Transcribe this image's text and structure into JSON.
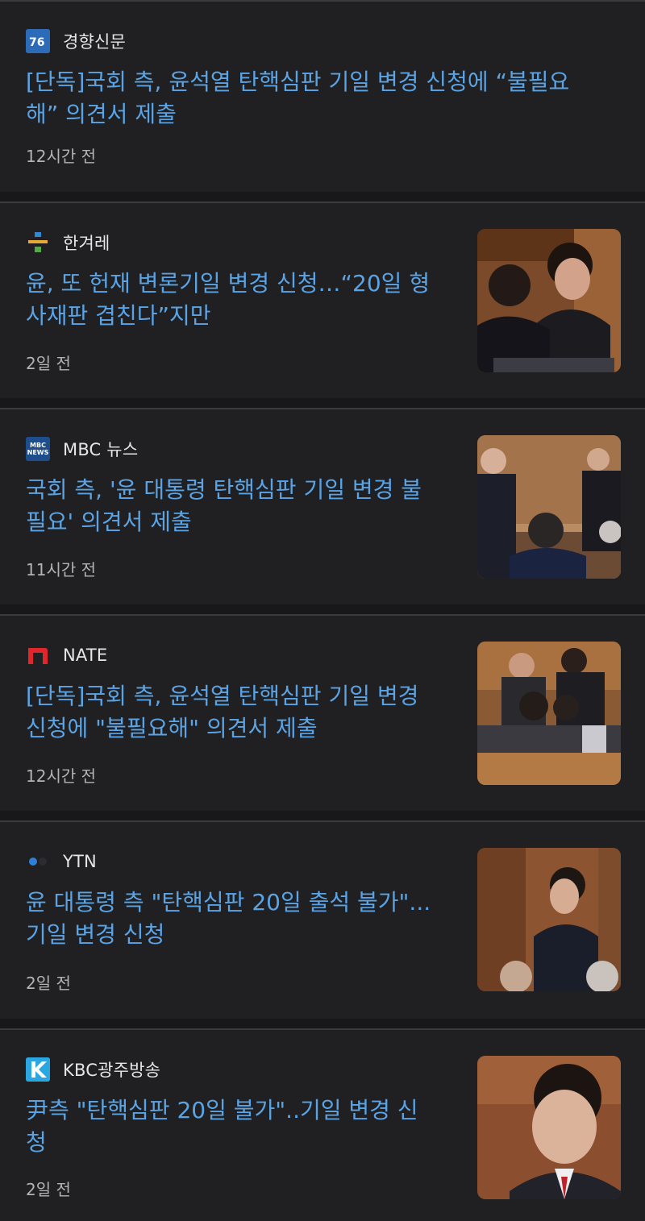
{
  "articles": [
    {
      "source": "경향신문",
      "logo": "kh-logo",
      "title": "[단독]국회 측, 윤석열 탄핵심판 기일 변경 신청에 “불필요해” 의견서 제출",
      "title_line1": "[단독]국회 측, 윤석열 탄핵심판 기일 변경 신청에 “불필요",
      "title_line2": "해” 의견서 제출",
      "time": "12시간 전"
    },
    {
      "source": "한겨레",
      "logo": "hani-logo",
      "title": "윤, 또 헌재 변론기일 변경 신청…“20일 형사재판 겹친다”지만",
      "title_line1": "윤, 또 헌재 변론기일 변경 신청…“20일 형",
      "title_line2": "사재판 겹친다”지만",
      "time": "2일 전"
    },
    {
      "source": "MBC 뉴스",
      "logo": "mbc-news-logo",
      "logo_text": "MBC NEWS",
      "title": "국회 측, '윤 대통령 탄핵심판 기일 변경 불필요' 의견서 제출",
      "title_line1": "국회 측, '윤 대통령 탄핵심판 기일 변경 불",
      "title_line2": "필요' 의견서 제출",
      "time": "11시간 전"
    },
    {
      "source": "NATE",
      "logo": "nate-logo",
      "title": "[단독]국회 측, 윤석열 탄핵심판 기일 변경 신청에 \"불필요해\" 의견서 제출",
      "title_line1": "[단독]국회 측, 윤석열 탄핵심판 기일 변경",
      "title_line2": "신청에 \"불필요해\" 의견서 제출",
      "time": "12시간 전"
    },
    {
      "source": "YTN",
      "logo": "ytn-logo",
      "title": "윤 대통령 측 \"탄핵심판 20일 출석 불가\"... 기일 변경 신청",
      "title_line1": "윤 대통령 측 \"탄핵심판 20일 출석 불가\"...",
      "title_line2": "기일 변경 신청",
      "time": "2일 전"
    },
    {
      "source": "KBC광주방송",
      "logo": "kbc-logo",
      "title": "尹측 \"탄핵심판 20일 불가\"..기일 변경 신청",
      "title_line1": "尹측 \"탄핵심판 20일 불가\"..기일 변경 신",
      "title_line2": "청",
      "time": "2일 전"
    }
  ],
  "colors": {
    "background": "#1f1f21",
    "title": "#5aa4e6",
    "source": "#e6e6e6",
    "time": "#b3b3b3",
    "divider": "#3a3a3d"
  }
}
